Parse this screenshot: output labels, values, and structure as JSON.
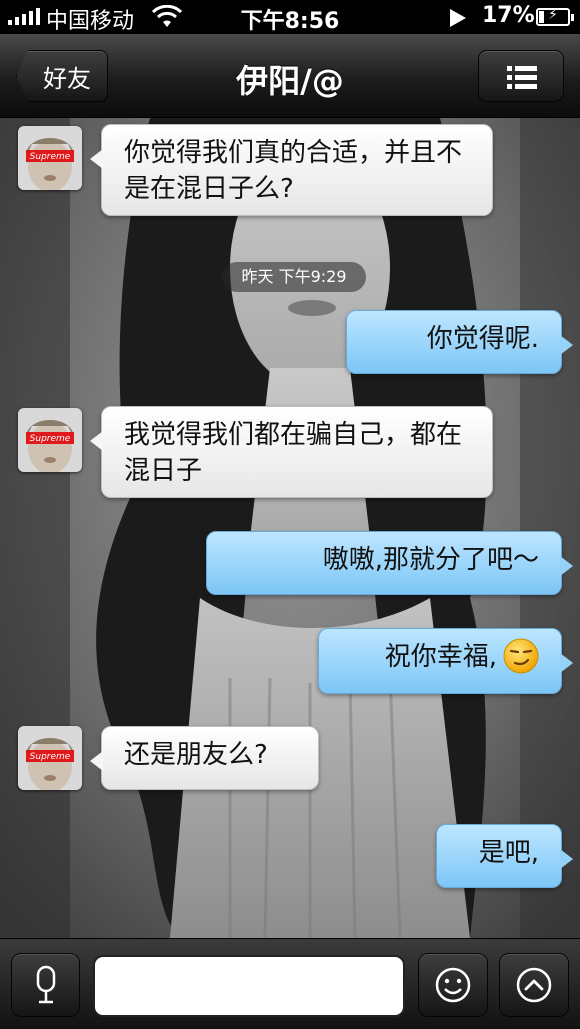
{
  "status_bar": {
    "carrier": "中国移动",
    "time": "下午8:56",
    "battery": "17%",
    "icons": [
      "signal-icon",
      "wifi-icon",
      "play-icon",
      "battery-charging-icon"
    ]
  },
  "nav": {
    "back_label": "好友",
    "title": "伊阳/@",
    "menu_icon": "list-menu-icon"
  },
  "chat": {
    "messages": [
      {
        "direction": "incoming",
        "text": "你觉得我们真的合适，并且不是在混日子么?"
      },
      {
        "direction": "timestamp",
        "text": "昨天 下午9:29"
      },
      {
        "direction": "outgoing",
        "text": "你觉得呢."
      },
      {
        "direction": "incoming",
        "text": "我觉得我们都在骗自己，都在混日子"
      },
      {
        "direction": "outgoing",
        "text": "嗷嗷,那就分了吧～"
      },
      {
        "direction": "outgoing",
        "text": "祝你幸福,",
        "emoji": "smirk-emoji"
      },
      {
        "direction": "incoming",
        "text": "还是朋友么?"
      },
      {
        "direction": "outgoing",
        "text": "是吧,"
      }
    ],
    "avatar_label": "Supreme"
  },
  "input_bar": {
    "voice_icon": "microphone-icon",
    "text_value": "",
    "emoji_icon": "smiley-icon",
    "more_icon": "chevron-up-icon"
  },
  "colors": {
    "incoming_bubble": "#ffffff",
    "outgoing_bubble": "#8ccff8",
    "bar": "#1a1a1a"
  }
}
